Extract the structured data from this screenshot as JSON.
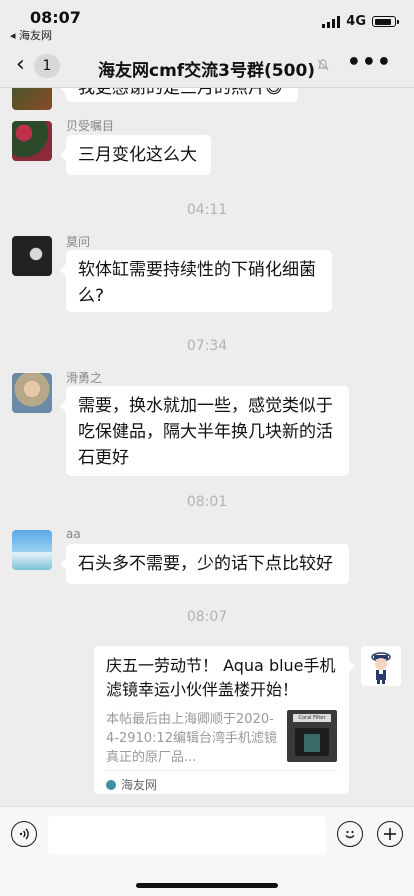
{
  "status_bar": {
    "time": "08:07",
    "back_app": "◂ 海友网",
    "network": "4G"
  },
  "nav": {
    "back_count": "1",
    "title": "海友网cmf交流3号群(500)"
  },
  "messages": [
    {
      "sender": "",
      "text": "我更感谢的是三月的照片😄"
    },
    {
      "sender": "贝受嘱目",
      "text": "三月变化这么大"
    },
    {
      "sender": "莫问",
      "text": "软体缸需要持续性的下硝化细菌么?"
    },
    {
      "sender": "滑勇之",
      "text": "需要，换水就加一些，感觉类似于吃保健品，隔大半年换几块新的活石更好"
    },
    {
      "sender": "aa",
      "text": "石头多不需要，少的话下点比较好"
    }
  ],
  "timestamps": [
    "04:11",
    "07:34",
    "08:01",
    "08:07"
  ],
  "link_card": {
    "title": "庆五一劳动节！ Aqua blue手机滤镜幸运小伙伴盖楼开始！",
    "description": "本帖最后由上海卿顺于2020-4-2910:12编辑台湾手机滤镜真正的原厂品...",
    "thumbnail_label": "Coral Filter",
    "source": "海友网"
  },
  "colors": {
    "background": "#ededed",
    "bubble": "#ffffff",
    "timestamp": "#b2b2b2"
  }
}
